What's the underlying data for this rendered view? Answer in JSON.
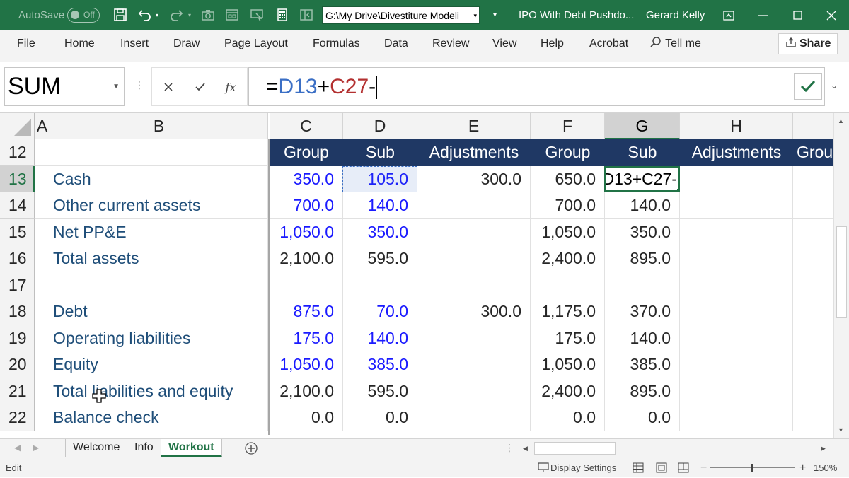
{
  "title_bar": {
    "autosave_label": "AutoSave",
    "autosave_state": "Off",
    "file_path": "G:\\My Drive\\Divestiture Modeli",
    "document_title": "IPO With Debt Pushdo...",
    "user_name": "Gerard Kelly"
  },
  "ribbon": {
    "tabs": [
      "File",
      "Home",
      "Insert",
      "Draw",
      "Page Layout",
      "Formulas",
      "Data",
      "Review",
      "View",
      "Help",
      "Acrobat"
    ],
    "tell_me": "Tell me",
    "share_label": "Share"
  },
  "formula_bar": {
    "name_box": "SUM",
    "fx_label": "fx",
    "formula_prefix": "=",
    "formula_ref1": "D13",
    "formula_op": "+",
    "formula_ref2": "C27",
    "formula_suffix": "-"
  },
  "grid": {
    "columns": [
      "A",
      "B",
      "C",
      "D",
      "E",
      "F",
      "G",
      "H"
    ],
    "header_row": {
      "row": "12",
      "labels": [
        "Group",
        "Sub",
        "Adjustments",
        "Group",
        "Sub",
        "Adjustments",
        "Grou"
      ]
    },
    "rows": [
      {
        "row": "13",
        "label": "Cash",
        "c": "350.0",
        "d": "105.0",
        "e": "300.0",
        "f": "650.0",
        "g": ""
      },
      {
        "row": "14",
        "label": "Other current assets",
        "c": "700.0",
        "d": "140.0",
        "e": "",
        "f": "700.0",
        "g": "140.0"
      },
      {
        "row": "15",
        "label": "Net PP&E",
        "c": "1,050.0",
        "d": "350.0",
        "e": "",
        "f": "1,050.0",
        "g": "350.0"
      },
      {
        "row": "16",
        "label": "Total assets",
        "c": "2,100.0",
        "d": "595.0",
        "e": "",
        "f": "2,400.0",
        "g": "895.0"
      },
      {
        "row": "17",
        "label": "",
        "c": "",
        "d": "",
        "e": "",
        "f": "",
        "g": ""
      },
      {
        "row": "18",
        "label": "Debt",
        "c": "875.0",
        "d": "70.0",
        "e": "300.0",
        "f": "1,175.0",
        "g": "370.0"
      },
      {
        "row": "19",
        "label": "Operating liabilities",
        "c": "175.0",
        "d": "140.0",
        "e": "",
        "f": "175.0",
        "g": "140.0"
      },
      {
        "row": "20",
        "label": "Equity",
        "c": "1,050.0",
        "d": "385.0",
        "e": "",
        "f": "1,050.0",
        "g": "385.0"
      },
      {
        "row": "21",
        "label": "Total liabilities and equity",
        "c": "2,100.0",
        "d": "595.0",
        "e": "",
        "f": "2,400.0",
        "g": "895.0"
      },
      {
        "row": "22",
        "label": "Balance check",
        "c": "0.0",
        "d": "0.0",
        "e": "",
        "f": "0.0",
        "g": "0.0"
      }
    ],
    "active_cell_text": "=D13+C27-"
  },
  "sheet_tabs": [
    "Welcome",
    "Info",
    "Workout"
  ],
  "status_bar": {
    "mode": "Edit",
    "display_settings": "Display Settings",
    "zoom": "150%"
  },
  "colors": {
    "excel_green": "#217346",
    "header_navy": "#1f3864",
    "input_blue": "#1a1aff",
    "label_blue": "#1f4e79"
  }
}
